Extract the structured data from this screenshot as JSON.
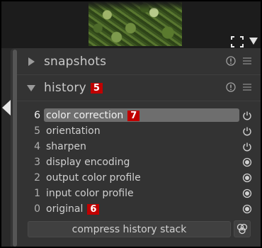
{
  "top": {
    "focus_icon": "focus-frame-icon",
    "dropdown_icon": "triangle-down-icon"
  },
  "gutter": {
    "collapse_icon": "triangle-left-icon"
  },
  "snapshots": {
    "label": "snapshots",
    "expanded": false,
    "icons": [
      "reset-icon",
      "presets-menu-icon"
    ]
  },
  "history": {
    "label": "history",
    "badge": "5",
    "expanded": true,
    "icons": [
      "reset-icon",
      "presets-menu-icon"
    ],
    "items": [
      {
        "num": "6",
        "label": "color correction",
        "badge": "7",
        "selected": true,
        "state": "power-icon"
      },
      {
        "num": "5",
        "label": "orientation",
        "badge": "",
        "selected": false,
        "state": "power-icon"
      },
      {
        "num": "4",
        "label": "sharpen",
        "badge": "",
        "selected": false,
        "state": "power-icon"
      },
      {
        "num": "3",
        "label": "display encoding",
        "badge": "",
        "selected": false,
        "state": "always-on-icon"
      },
      {
        "num": "2",
        "label": "output color profile",
        "badge": "",
        "selected": false,
        "state": "always-on-icon"
      },
      {
        "num": "1",
        "label": "input color profile",
        "badge": "",
        "selected": false,
        "state": "always-on-icon"
      },
      {
        "num": "0",
        "label": "original",
        "badge": "6",
        "selected": false,
        "state": "always-on-icon"
      }
    ],
    "compress_label": "compress history stack",
    "styles_icon": "create-style-icon"
  },
  "colors": {
    "badge": "#c00000",
    "panel": "#333333",
    "selected_row": "#6e6e6e",
    "text": "#cfcfcf"
  }
}
